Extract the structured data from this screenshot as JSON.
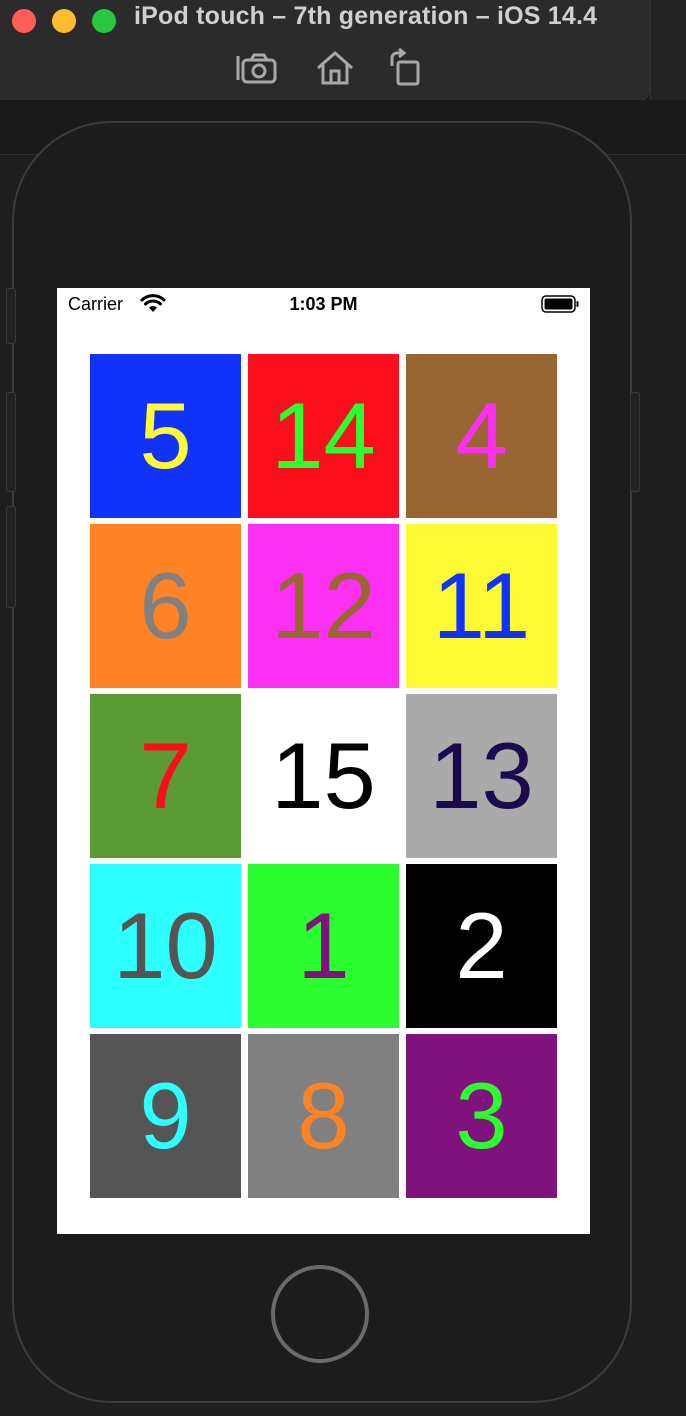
{
  "window": {
    "title": "iPod touch – 7th generation – iOS 14.4",
    "toolbar_icons": [
      "screenshot-icon",
      "home-icon",
      "rotate-icon"
    ]
  },
  "status_bar": {
    "carrier": "Carrier",
    "time": "1:03 PM"
  },
  "tiles": [
    {
      "label": "5",
      "bg": "#1132fb",
      "fg": "#fefb35"
    },
    {
      "label": "14",
      "bg": "#fb0d1b",
      "fg": "#2bfd31"
    },
    {
      "label": "4",
      "bg": "#996633",
      "fg": "#fb30f2"
    },
    {
      "label": "6",
      "bg": "#fd8325",
      "fg": "#808080"
    },
    {
      "label": "12",
      "bg": "#fb30f2",
      "fg": "#996633"
    },
    {
      "label": "11",
      "bg": "#fefb35",
      "fg": "#1132fb"
    },
    {
      "label": "7",
      "bg": "#5b9a35",
      "fg": "#fb0d1b"
    },
    {
      "label": "15",
      "bg": "#ffffff",
      "fg": "#000000"
    },
    {
      "label": "13",
      "bg": "#aaaaaa",
      "fg": "#1b0a4d"
    },
    {
      "label": "10",
      "bg": "#2dfefe",
      "fg": "#555555"
    },
    {
      "label": "1",
      "bg": "#2bfd31",
      "fg": "#80127e"
    },
    {
      "label": "2",
      "bg": "#000000",
      "fg": "#ffffff"
    },
    {
      "label": "9",
      "bg": "#555555",
      "fg": "#2dfefe"
    },
    {
      "label": "8",
      "bg": "#808080",
      "fg": "#fd8325"
    },
    {
      "label": "3",
      "bg": "#80127e",
      "fg": "#2bfd31"
    }
  ]
}
